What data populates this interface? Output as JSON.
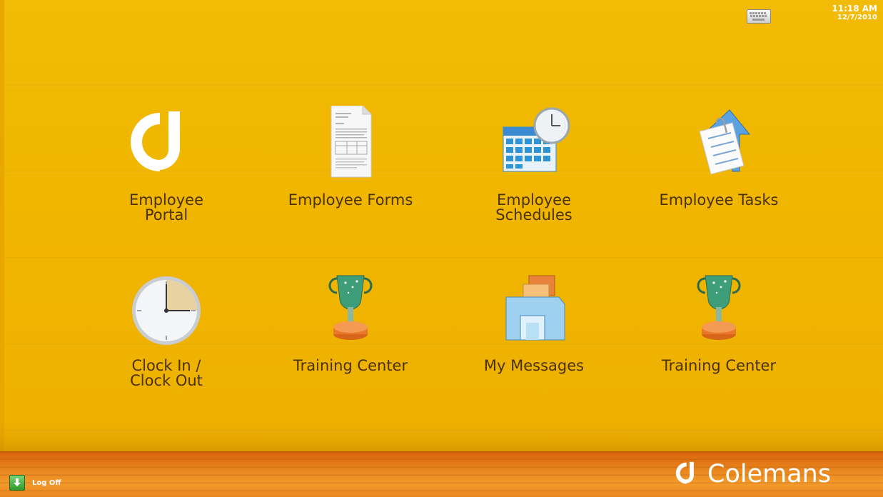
{
  "status": {
    "time": "11:18 AM",
    "date": "12/7/2010"
  },
  "tiles": [
    {
      "label": "Employee\nPortal",
      "icon": "colemans-logo-icon"
    },
    {
      "label": "Employee Forms",
      "icon": "document-icon"
    },
    {
      "label": "Employee\nSchedules",
      "icon": "calendar-clock-icon"
    },
    {
      "label": "Employee Tasks",
      "icon": "task-list-icon"
    },
    {
      "label": "Clock In /\nClock Out",
      "icon": "clock-icon"
    },
    {
      "label": "Training Center",
      "icon": "trophy-icon"
    },
    {
      "label": "My Messages",
      "icon": "mailbox-icon"
    },
    {
      "label": "Training Center",
      "icon": "trophy-icon"
    }
  ],
  "footer": {
    "logoff_label": "Log Off",
    "brand_name": "Colemans"
  }
}
